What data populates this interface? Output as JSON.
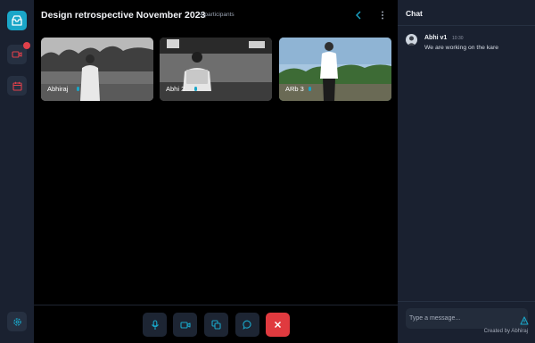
{
  "meeting": {
    "title": "Design retrospective November 2023",
    "participants": "4 participants"
  },
  "participants": [
    {
      "name": "Abhiraj",
      "mic": "mic-icon"
    },
    {
      "name": "Abhi 2",
      "mic": "mic-icon"
    },
    {
      "name": "ARb 3",
      "mic": "mic-icon"
    }
  ],
  "sidebar": {
    "items": [
      {
        "icon": "logo-box-icon",
        "active": true
      },
      {
        "icon": "video-icon",
        "notification": true
      },
      {
        "icon": "calendar-icon"
      },
      {
        "icon": "settings-icon"
      }
    ]
  },
  "controls": [
    {
      "icon": "mic-icon"
    },
    {
      "icon": "video-icon"
    },
    {
      "icon": "screen-share-icon"
    },
    {
      "icon": "chat-bubble-icon"
    },
    {
      "icon": "close-icon"
    }
  ],
  "chat": {
    "title": "Chat",
    "messages": [
      {
        "author": "Abhi v1",
        "time": "10:30",
        "text": "We are working on the kare"
      }
    ],
    "input_placeholder": "Type a message...",
    "credit": "Created by Abhiraj"
  },
  "colors": {
    "accent": "#1aa6c8",
    "danger": "#e03a3f",
    "panel": "#1a2130",
    "stage": "#000000"
  }
}
